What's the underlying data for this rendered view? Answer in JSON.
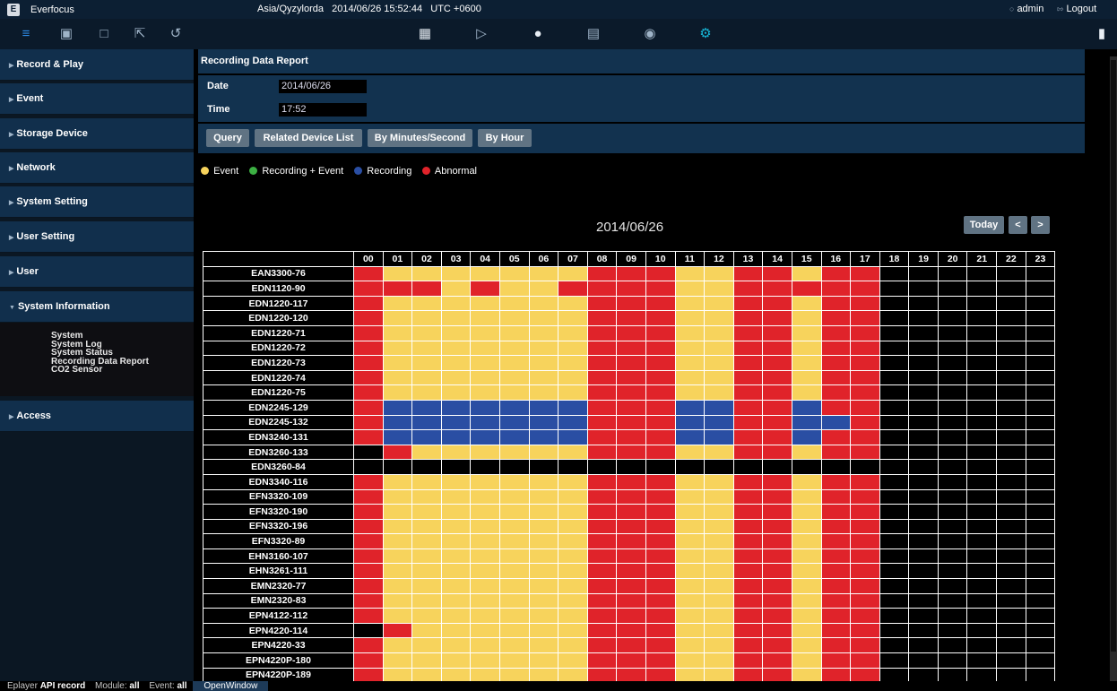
{
  "topbar": {
    "brand": "Everfocus",
    "timezone": "Asia/Qyzylorda",
    "datetime": "2014/06/26 15:52:44",
    "utc": "UTC +0600",
    "user": "admin",
    "logout": "Logout"
  },
  "toolbar": {
    "icons": [
      "menu-icon",
      "window-stack-icon",
      "monitor-icon",
      "fullscreen-icon",
      "playback-icon",
      "grid-icon",
      "play-circle-icon",
      "alert-icon",
      "info-icon",
      "record-icon",
      "gear-icon",
      "lock-icon"
    ]
  },
  "sidebar": {
    "items": [
      {
        "label": "Record & Play"
      },
      {
        "label": "Event"
      },
      {
        "label": "Storage Device"
      },
      {
        "label": "Network"
      },
      {
        "label": "System Setting"
      },
      {
        "label": "User Setting"
      },
      {
        "label": "User"
      },
      {
        "label": "System Information"
      },
      {
        "label": "Access"
      }
    ],
    "submenu": [
      "System",
      "System Log",
      "System Status",
      "Recording Data Report",
      "CO2 Sensor"
    ]
  },
  "report": {
    "title": "Recording Data Report",
    "date_label": "Date",
    "date_value": "2014/06/26",
    "time_label": "Time",
    "time_value": "17:52",
    "buttons": [
      "Query",
      "Related Device List",
      "By Minutes/Second",
      "By Hour"
    ]
  },
  "legend": [
    {
      "label": "Event",
      "color": "#f7d35c"
    },
    {
      "label": "Recording + Event",
      "color": "#3cb043"
    },
    {
      "label": "Recording",
      "color": "#2a4ea3"
    },
    {
      "label": "Abnormal",
      "color": "#e0232a"
    }
  ],
  "chart": {
    "date": "2014/06/26",
    "today": "Today",
    "prev": "<",
    "next": ">",
    "hours": [
      "00",
      "01",
      "02",
      "03",
      "04",
      "05",
      "06",
      "07",
      "08",
      "09",
      "10",
      "11",
      "12",
      "13",
      "14",
      "15",
      "16",
      "17",
      "18",
      "19",
      "20",
      "21",
      "22",
      "23"
    ],
    "status_colors": {
      "E": "#f7d35c",
      "R": "#2a4ea3",
      "A": "#e0232a",
      "N": "#000000"
    },
    "rows": [
      {
        "device": "EAN3300-76",
        "status": "AEEEEEEEAAAEEAAEAA"
      },
      {
        "device": "EDN1120-90",
        "status": "AAAEAEEAAAAEEAAAAA"
      },
      {
        "device": "EDN1220-117",
        "status": "AEEEEEEEAAAEEAAEAA"
      },
      {
        "device": "EDN1220-120",
        "status": "AEEEEEEEAAAEEAAEAA"
      },
      {
        "device": "EDN1220-71",
        "status": "AEEEEEEEAAAEEAAEAA"
      },
      {
        "device": "EDN1220-72",
        "status": "AEEEEEEEAAAEEAAEAA"
      },
      {
        "device": "EDN1220-73",
        "status": "AEEEEEEEAAAEEAAEAA"
      },
      {
        "device": "EDN1220-74",
        "status": "AEEEEEEEAAAEEAAEAA"
      },
      {
        "device": "EDN1220-75",
        "status": "AEEEEEEEAAAEEAAEAA"
      },
      {
        "device": "EDN2245-129",
        "status": "ARRRRRRRAAARRAARAA"
      },
      {
        "device": "EDN2245-132",
        "status": "ARRRRRRRAAARRAARRA"
      },
      {
        "device": "EDN3240-131",
        "status": "ARRRRRRRAAARRAARAA"
      },
      {
        "device": "EDN3260-133",
        "status": "NAEEEEEEAAAEEAAEAA"
      },
      {
        "device": "EDN3260-84",
        "status": "NNNNNNNNNNNNNNNNNN"
      },
      {
        "device": "EDN3340-116",
        "status": "AEEEEEEEAAAEEAAEAA"
      },
      {
        "device": "EFN3320-109",
        "status": "AEEEEEEEAAAEEAAEAA"
      },
      {
        "device": "EFN3320-190",
        "status": "AEEEEEEEAAAEEAAEAA"
      },
      {
        "device": "EFN3320-196",
        "status": "AEEEEEEEAAAEEAAEAA"
      },
      {
        "device": "EFN3320-89",
        "status": "AEEEEEEEAAAEEAAEAA"
      },
      {
        "device": "EHN3160-107",
        "status": "AEEEEEEEAAAEEAAEAA"
      },
      {
        "device": "EHN3261-111",
        "status": "AEEEEEEEAAAEEAAEAA"
      },
      {
        "device": "EMN2320-77",
        "status": "AEEEEEEEAAAEEAAEAA"
      },
      {
        "device": "EMN2320-83",
        "status": "AEEEEEEEAAAEEAAEAA"
      },
      {
        "device": "EPN4122-112",
        "status": "AEEEEEEEAAAEEAAEAA"
      },
      {
        "device": "EPN4220-114",
        "status": "NAEEEEEEAAAEEAAEAA"
      },
      {
        "device": "EPN4220-33",
        "status": "AEEEEEEEAAAEEAAEAA"
      },
      {
        "device": "EPN4220P-180",
        "status": "AEEEEEEEAAAEEAAEAA"
      },
      {
        "device": "EPN4220P-189",
        "status": "AEEEEEEEAAAEEAAEAA"
      }
    ]
  },
  "statusbar": {
    "player_label": "Eplayer",
    "player_value": "API record",
    "module_label": "Module:",
    "module_value": "all",
    "event_label": "Event:",
    "event_value": "all",
    "open_window": "OpenWindow"
  }
}
